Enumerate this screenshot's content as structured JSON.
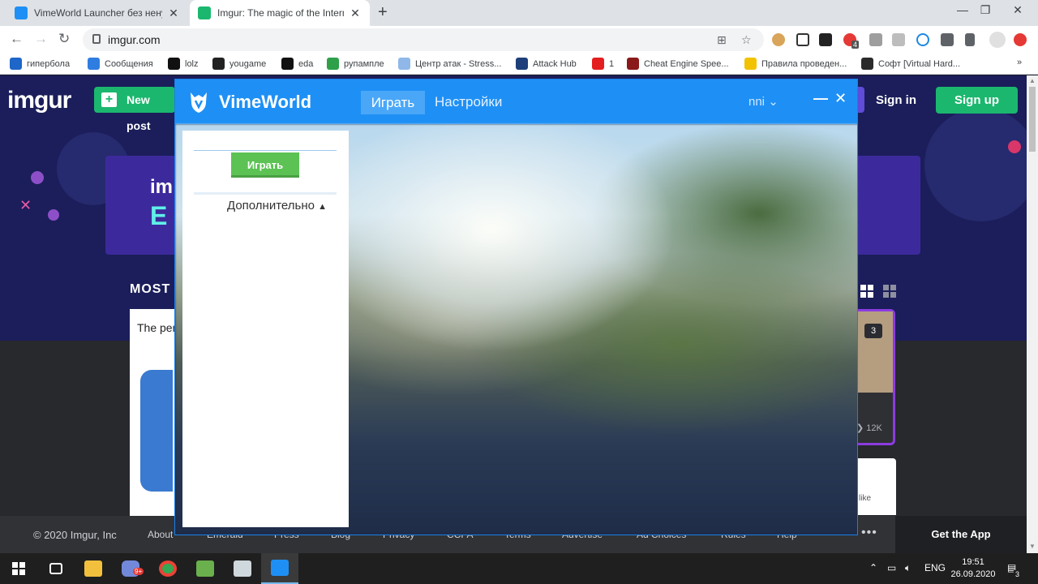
{
  "browser": {
    "tabs": [
      {
        "title": "VimeWorld Launcher без ненужн",
        "active": false
      },
      {
        "title": "Imgur: The magic of the Internet",
        "active": true
      }
    ],
    "new_tab": "+",
    "window_controls": {
      "minimize": "—",
      "maximize": "❐",
      "close": "✕"
    },
    "url": "imgur.com",
    "bookmarks": [
      {
        "label": "гипербола",
        "icon_color": "#1e66c8"
      },
      {
        "label": "Сообщения",
        "icon_color": "#2f7de1"
      },
      {
        "label": "lolz",
        "icon_color": "#111111"
      },
      {
        "label": "yougame",
        "icon_color": "#222222"
      },
      {
        "label": "eda",
        "icon_color": "#111111"
      },
      {
        "label": "рупампле",
        "icon_color": "#2ea04a"
      },
      {
        "label": "Центр атак - Stress...",
        "icon_color": "#8fb8e8"
      },
      {
        "label": "Attack Hub",
        "icon_color": "#1e3f7a"
      },
      {
        "label": "1",
        "icon_color": "#e41e1e"
      },
      {
        "label": "Cheat Engine Spee...",
        "icon_color": "#8a1a1a"
      },
      {
        "label": "Правила проведен...",
        "icon_color": "#f2c200"
      },
      {
        "label": "Софт [Virtual Hard...",
        "icon_color": "#2b2b2b"
      }
    ],
    "bookmarks_more": "»",
    "extension_badge": "4"
  },
  "imgur": {
    "logo": "imgur",
    "new_post": "New post",
    "sign_in": "Sign in",
    "sign_up": "Sign up",
    "banner_text_1": "im",
    "banner_text_2": "E",
    "section_title": "MOST",
    "card_left_text": "The per",
    "card_right_badge": "3",
    "card_right_views": "12K",
    "card_r2_text": "like",
    "footer": {
      "copyright": "© 2020 Imgur, Inc",
      "links": [
        "About",
        "Emerald",
        "Press",
        "Blog",
        "Privacy",
        "CCPA",
        "Terms",
        "Advertise",
        "Ad Choices",
        "Rules",
        "Help"
      ],
      "get_app": "Get the App"
    }
  },
  "launcher": {
    "brand": "VimeWorld",
    "tab_play": "Играть",
    "tab_settings": "Настройки",
    "user": "nni",
    "play_button": "Играть",
    "more_label": "Дополнительно",
    "accent": "#1e90f5",
    "play_color": "#5cc254"
  },
  "taskbar": {
    "language": "ENG",
    "time": "19:51",
    "date": "26.09.2020",
    "notifications": "3",
    "discord_badge": "9+"
  }
}
